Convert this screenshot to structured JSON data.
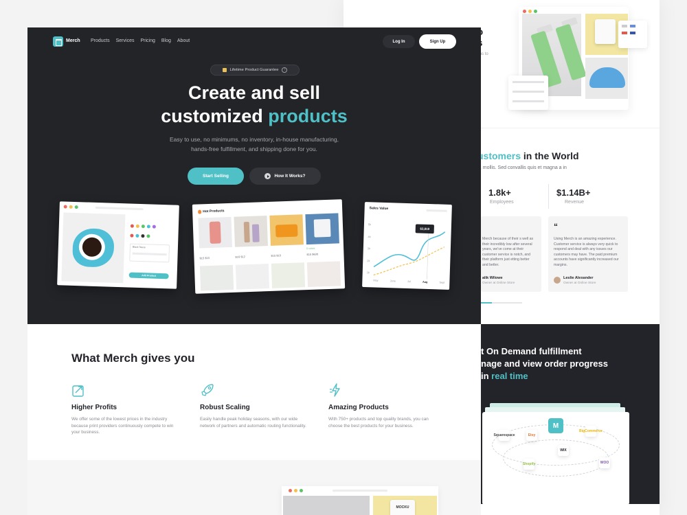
{
  "nav": {
    "brand": "Merch",
    "links": [
      "Products",
      "Services",
      "Pricing",
      "Blog",
      "About"
    ],
    "login": "Log In",
    "signup": "Sign Up"
  },
  "hero": {
    "badge": "Lifetime Product Guarantee",
    "title_line1": "Create and sell",
    "title_line2_plain": "customized ",
    "title_line2_accent": "products",
    "desc_line1": "Easy to use, no minimums, no inventory, in-house manufacturing,",
    "desc_line2": "hands-free fulfillment, and shipping done for you.",
    "cta_primary": "Start Selling",
    "cta_secondary": "How It Works?"
  },
  "cards": {
    "designer": {
      "button": "Add Product",
      "field": "Black Teeze"
    },
    "products": {
      "title": "Hot Products",
      "items": [
        {
          "price": "$15 $10"
        },
        {
          "price": "$16 $12"
        },
        {
          "price": "$15 $10"
        },
        {
          "price": "$15 $630"
        }
      ],
      "badge": "5 colors"
    },
    "sales": {
      "title": "Sales Value",
      "tooltip": "$3,819",
      "y_ticks": [
        "5k",
        "4k",
        "3k",
        "2k",
        "1k"
      ],
      "x_ticks": [
        "May",
        "June",
        "Jul",
        "Aug",
        "Sept"
      ]
    }
  },
  "gives": {
    "title": "What Merch gives you",
    "features": [
      {
        "title": "Higher Profits",
        "desc": "We offer some of the lowest prices in the industry because print providers continuously compete to win your business."
      },
      {
        "title": "Robust Scaling",
        "desc": "Easily handle peak holiday seasons, with our wide network of partners and automatic routing functionality."
      },
      {
        "title": "Amazing Products",
        "desc": "With 750+ products and top quality brands, you can choose the best products for your business."
      }
    ]
  },
  "back": {
    "top_heading_1": "to",
    "top_heading_2": "ts",
    "top_sub": "signs to",
    "customers_accent": "ustomers",
    "customers_plain": " in the World",
    "customers_sub": "a, mollis. Sed convallis quis et magna a in",
    "stats": [
      {
        "value": "1.8k+",
        "label": "Employees"
      },
      {
        "value": "$1.14B+",
        "label": "Revenue"
      }
    ],
    "testimonials": [
      {
        "text": "Merch because of their s well as their incredibly low after several years, we've come at their customer service is notch, and their platform just etting better and better.",
        "name": "alik Wilowe",
        "role": "Owner at Online Store"
      },
      {
        "text": "Using Merch is an amazing experience. Customer service is always very quick to respond and deal with any issues our customers may have. The paid premium accounts have significantly increased our margins.",
        "name": "Leslie Alexander",
        "role": "Owner at Online Store"
      }
    ],
    "fulfill_line1": "t On Demand fulfillment",
    "fulfill_line2": "nage and view order progress",
    "fulfill_line3_plain": " in ",
    "fulfill_line3_accent": "real time",
    "integrations": [
      "Etsy",
      "WIX",
      "WOO",
      "Shopify",
      "Squarespace",
      "BigCommerce"
    ]
  },
  "next_mock": {
    "mug_label": "MOCKU"
  },
  "colors": {
    "accent": "#4fc0c5",
    "dark": "#23242a",
    "white": "#ffffff"
  }
}
